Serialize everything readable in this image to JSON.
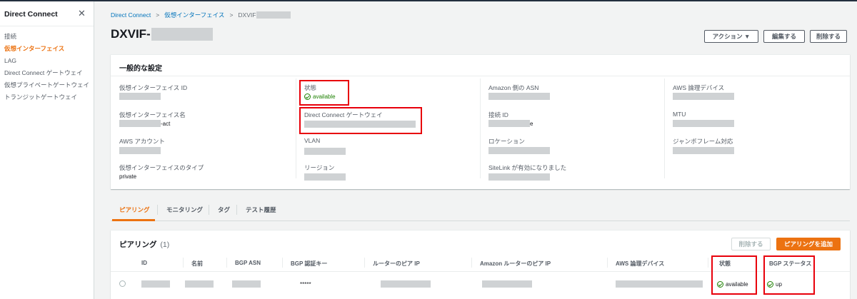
{
  "sidebar": {
    "title": "Direct Connect",
    "close_icon": "close-icon",
    "items": [
      {
        "label": "接続",
        "active": false
      },
      {
        "label": "仮想インターフェイス",
        "active": true
      },
      {
        "label": "LAG",
        "active": false
      },
      {
        "label": "Direct Connect ゲートウェイ",
        "active": false
      },
      {
        "label": "仮想プライベートゲートウェイ",
        "active": false
      },
      {
        "label": "トランジットゲートウェイ",
        "active": false
      }
    ]
  },
  "breadcrumb": {
    "home": "Direct Connect",
    "section": "仮想インターフェイス",
    "current": "DXVIF"
  },
  "page": {
    "title": "DXVIF-"
  },
  "actions": {
    "action_label": "アクション ▼",
    "edit_label": "編集する",
    "delete_label": "削除する"
  },
  "general": {
    "title": "一般的な設定",
    "fields": {
      "vif_id": {
        "label": "仮想インターフェイス ID",
        "value": ""
      },
      "vif_name": {
        "label": "仮想インターフェイス名",
        "value": "-act"
      },
      "aws_account": {
        "label": "AWS アカウント",
        "value": ""
      },
      "vif_type": {
        "label": "仮想インターフェイスのタイプ",
        "value": "private"
      },
      "state": {
        "label": "状態",
        "value": "available"
      },
      "dx_gateway": {
        "label": "Direct Connect ゲートウェイ",
        "value": ""
      },
      "vlan": {
        "label": "VLAN",
        "value": ""
      },
      "region": {
        "label": "リージョン",
        "value": ""
      },
      "amazon_asn": {
        "label": "Amazon 側の ASN",
        "value": ""
      },
      "connection_id": {
        "label": "接続 ID",
        "value": "e"
      },
      "location": {
        "label": "ロケーション",
        "value": ""
      },
      "sitelink": {
        "label": "SiteLink が有効になりました",
        "value": ""
      },
      "aws_logical_device": {
        "label": "AWS 論理デバイス",
        "value": ""
      },
      "mtu": {
        "label": "MTU",
        "value": ""
      },
      "jumbo": {
        "label": "ジャンボフレーム対応",
        "value": ""
      }
    }
  },
  "tabs": [
    {
      "label": "ピアリング",
      "active": true
    },
    {
      "label": "モニタリング",
      "active": false
    },
    {
      "label": "タグ",
      "active": false
    },
    {
      "label": "テスト履歴",
      "active": false
    }
  ],
  "peering": {
    "title": "ピアリング",
    "count": "(1)",
    "delete_label": "削除する",
    "add_label": "ピアリングを追加",
    "columns": [
      "ID",
      "名前",
      "BGP ASN",
      "BGP 認証キー",
      "ルーターのピア IP",
      "Amazon ルーターのピア IP",
      "AWS 論理デバイス",
      "状態",
      "BGP ステータス"
    ],
    "rows": [
      {
        "id": "",
        "name": "",
        "asn": "",
        "auth_key": "*****",
        "router_ip": "",
        "amazon_ip": "",
        "device": "",
        "state": "available",
        "bgp_status": "up"
      }
    ]
  },
  "colors": {
    "accent": "#ec7211",
    "link": "#0073bb",
    "success": "#1d8102",
    "highlight": "#e8000b"
  }
}
